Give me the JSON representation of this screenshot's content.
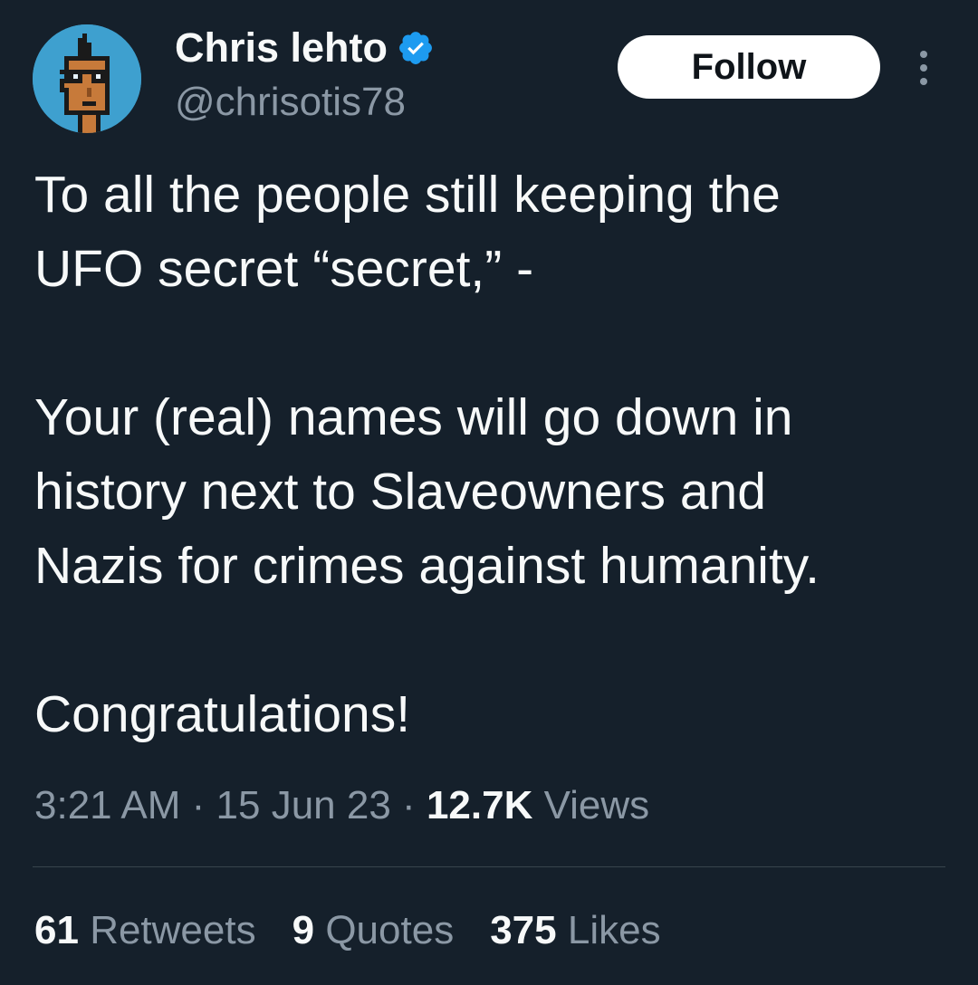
{
  "author": {
    "display_name": "Chris lehto",
    "handle": "@chrisotis78",
    "verified_icon": "verified-badge-icon",
    "avatar": "pixel-punk-avatar"
  },
  "actions": {
    "follow_label": "Follow",
    "more_icon": "more-options-icon"
  },
  "tweet": {
    "text": "To all the people still keeping the\nUFO secret “secret,” -\n\nYour (real) names will go down in\nhistory next to Slaveowners and\nNazis for crimes against humanity.\n\nCongratulations!",
    "time": "3:21 AM",
    "date": "15 Jun 23",
    "views_count": "12.7K",
    "views_label": "Views",
    "separator": " · "
  },
  "stats": {
    "retweets_count": "61",
    "retweets_label": "Retweets",
    "quotes_count": "9",
    "quotes_label": "Quotes",
    "likes_count": "375",
    "likes_label": "Likes"
  },
  "colors": {
    "background": "#15202b",
    "text_primary": "#f7f9f9",
    "text_secondary": "#8b98a5",
    "verified_blue": "#1d9bf0",
    "divider": "#38444d",
    "follow_bg": "#ffffff"
  }
}
